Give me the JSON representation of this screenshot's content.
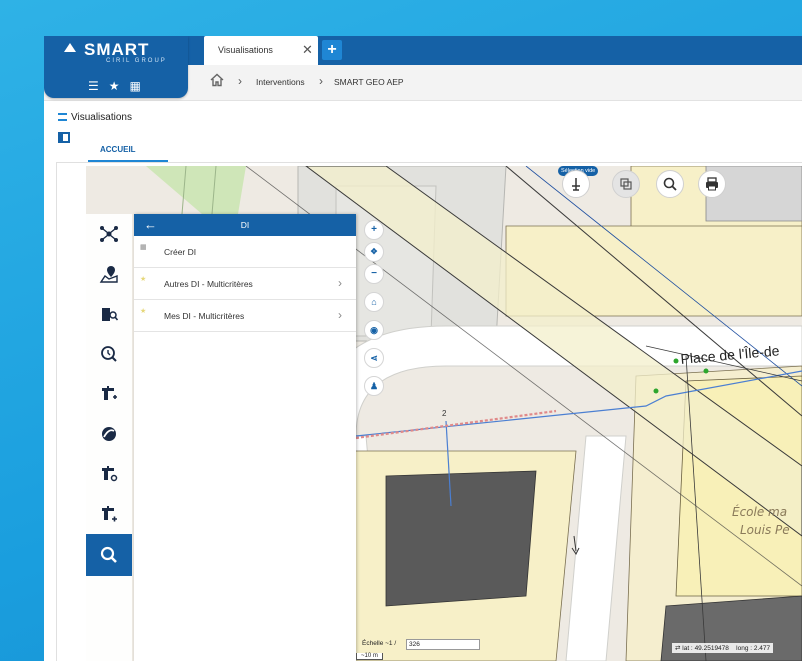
{
  "brand": {
    "name": "SMART",
    "tagline": "CIRIL GROUP"
  },
  "tabs": [
    {
      "label": "Visualisations",
      "active": true
    }
  ],
  "breadcrumb": {
    "items": [
      "Interventions",
      "SMART GEO AEP"
    ]
  },
  "page": {
    "title": "Visualisations",
    "subtab": "ACCUEIL"
  },
  "di_panel": {
    "title": "DI",
    "items": [
      {
        "label": "Créer DI",
        "has_submenu": false
      },
      {
        "label": "Autres DI - Multicritères",
        "has_submenu": true
      },
      {
        "label": "Mes DI - Multicritères",
        "has_submenu": true
      }
    ]
  },
  "map_tools": {
    "selection_badge": "Sélection vide"
  },
  "map_labels": {
    "street": "Place de l'Île-de",
    "school_line1": "École ma",
    "school_line2": "Louis Pe",
    "parcel_number": "2"
  },
  "scale": {
    "label": "Échelle ~1 /",
    "value": "326",
    "bar": "~10 m"
  },
  "coords": {
    "lat_label": "lat :",
    "lat": "49.2519478",
    "long_label": "long :",
    "long": "2.477"
  },
  "colors": {
    "brand_blue": "#1561a6",
    "accent_blue": "#1f86d4",
    "background": "#1a9ede"
  }
}
